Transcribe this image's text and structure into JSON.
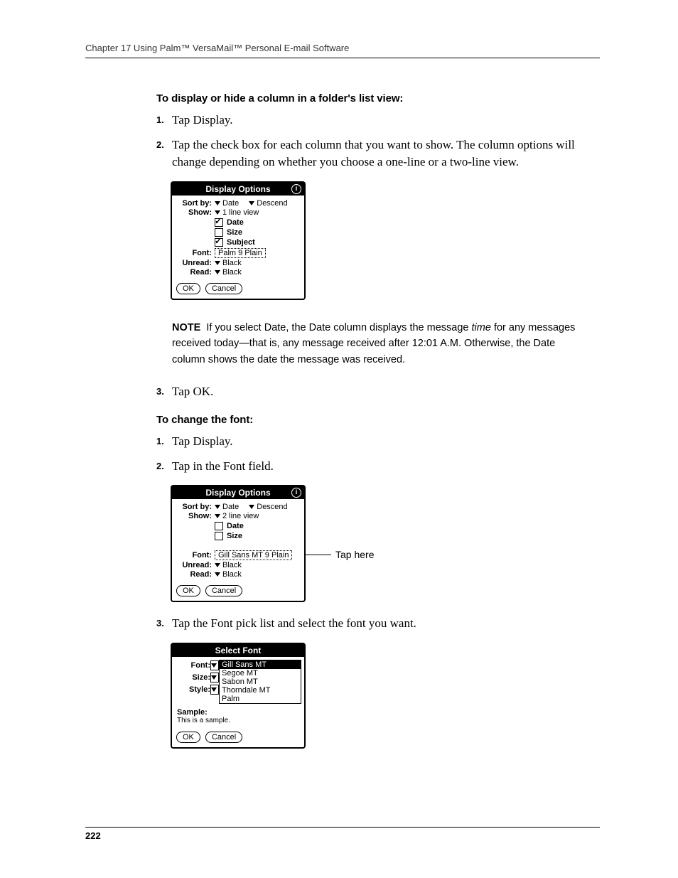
{
  "header": {
    "running_head": "Chapter 17   Using Palm™ VersaMail™ Personal E-mail Software"
  },
  "section1": {
    "heading": "To display or hide a column in a folder's list view:",
    "steps": [
      "Tap Display.",
      "Tap the check box for each column that you want to show. The column options will change depending on whether you choose a one-line or a two-line view."
    ],
    "step3": "Tap OK."
  },
  "dialog1": {
    "title": "Display Options",
    "sort_by_label": "Sort by:",
    "sort_by_value": "Date",
    "sort_order": "Descend",
    "show_label": "Show:",
    "show_value": "1 line view",
    "col_date": "Date",
    "col_size": "Size",
    "col_subject": "Subject",
    "font_label": "Font:",
    "font_value": "Palm 9 Plain",
    "unread_label": "Unread:",
    "unread_value": "Black",
    "read_label": "Read:",
    "read_value": "Black",
    "ok": "OK",
    "cancel": "Cancel"
  },
  "note": {
    "label": "NOTE",
    "text_pre": "If you select Date, the Date column displays the message ",
    "italic": "time",
    "text_post": " for any messages received today—that is, any message received after 12:01 A.M. Otherwise, the Date column shows the date the message was received."
  },
  "section2": {
    "heading": "To change the font:",
    "steps": [
      "Tap Display.",
      "Tap in the Font field."
    ],
    "step3": "Tap the Font pick list and select the font you want."
  },
  "dialog2": {
    "title": "Display Options",
    "sort_by_label": "Sort by:",
    "sort_by_value": "Date",
    "sort_order": "Descend",
    "show_label": "Show:",
    "show_value": "2 line view",
    "col_date": "Date",
    "col_size": "Size",
    "font_label": "Font:",
    "font_value": "Gill Sans MT 9 Plain",
    "unread_label": "Unread:",
    "unread_value": "Black",
    "read_label": "Read:",
    "read_value": "Black",
    "ok": "OK",
    "cancel": "Cancel",
    "callout": "Tap here"
  },
  "dialog3": {
    "title": "Select Font",
    "font_label": "Font:",
    "size_label": "Size:",
    "style_label": "Style:",
    "options": [
      "Gill Sans MT",
      "Segoe MT",
      "Sabon MT",
      "Thorndale MT",
      "Palm"
    ],
    "sample_label": "Sample:",
    "sample_text": "This is a sample.",
    "ok": "OK",
    "cancel": "Cancel"
  },
  "footer": {
    "page_number": "222"
  }
}
